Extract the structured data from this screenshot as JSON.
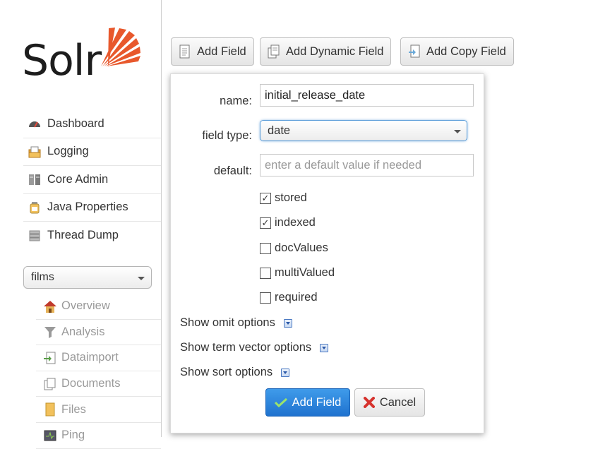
{
  "app": {
    "logo_text": "Solr"
  },
  "sidebar": {
    "items": [
      {
        "label": "Dashboard",
        "icon": "dashboard-icon"
      },
      {
        "label": "Logging",
        "icon": "logging-icon"
      },
      {
        "label": "Core Admin",
        "icon": "core-admin-icon"
      },
      {
        "label": "Java Properties",
        "icon": "java-properties-icon"
      },
      {
        "label": "Thread Dump",
        "icon": "thread-dump-icon"
      }
    ],
    "core_selector": {
      "value": "films"
    },
    "core_items": [
      {
        "label": "Overview",
        "icon": "overview-icon"
      },
      {
        "label": "Analysis",
        "icon": "analysis-icon"
      },
      {
        "label": "Dataimport",
        "icon": "dataimport-icon"
      },
      {
        "label": "Documents",
        "icon": "documents-icon"
      },
      {
        "label": "Files",
        "icon": "files-icon"
      },
      {
        "label": "Ping",
        "icon": "ping-icon"
      }
    ]
  },
  "toolbar": {
    "add_field": "Add Field",
    "add_dynamic_field": "Add Dynamic Field",
    "add_copy_field": "Add Copy Field"
  },
  "form": {
    "name_label": "name:",
    "name_value": "initial_release_date",
    "field_type_label": "field type:",
    "field_type_value": "date",
    "default_label": "default:",
    "default_placeholder": "enter a default value if needed",
    "checkboxes": [
      {
        "label": "stored",
        "checked": true
      },
      {
        "label": "indexed",
        "checked": true
      },
      {
        "label": "docValues",
        "checked": false
      },
      {
        "label": "multiValued",
        "checked": false
      },
      {
        "label": "required",
        "checked": false
      }
    ],
    "show_omit": "Show omit options",
    "show_term_vector": "Show term vector options",
    "show_sort": "Show sort options",
    "submit_label": "Add Field",
    "cancel_label": "Cancel"
  },
  "colors": {
    "logo_orange": "#e8582c",
    "primary_button": "#2a80dc",
    "cancel_x": "#d6322d",
    "check_green": "#8fd14f"
  }
}
